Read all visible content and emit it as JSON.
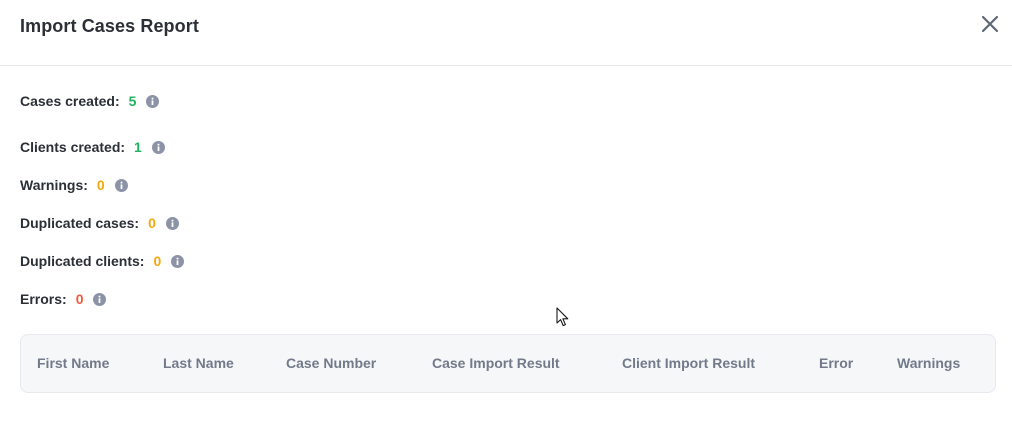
{
  "modal": {
    "title": "Import Cases Report"
  },
  "colors": {
    "success": "#22b35e",
    "warning": "#f2a90c",
    "error": "#ef5a3c",
    "info_icon": "#8c93a6"
  },
  "icons": {
    "close": "close-icon",
    "info": "info-icon"
  },
  "stats": [
    {
      "label": "Cases created:",
      "value": "5",
      "status": "success"
    },
    {
      "label": "Clients created:",
      "value": "1",
      "status": "success"
    },
    {
      "label": "Warnings:",
      "value": "0",
      "status": "warning"
    },
    {
      "label": "Duplicated cases:",
      "value": "0",
      "status": "warning"
    },
    {
      "label": "Duplicated clients:",
      "value": "0",
      "status": "warning"
    },
    {
      "label": "Errors:",
      "value": "0",
      "status": "error"
    }
  ],
  "table": {
    "columns": [
      "First Name",
      "Last Name",
      "Case Number",
      "Case Import Result",
      "Client Import Result",
      "Error",
      "Warnings"
    ],
    "rows": []
  }
}
